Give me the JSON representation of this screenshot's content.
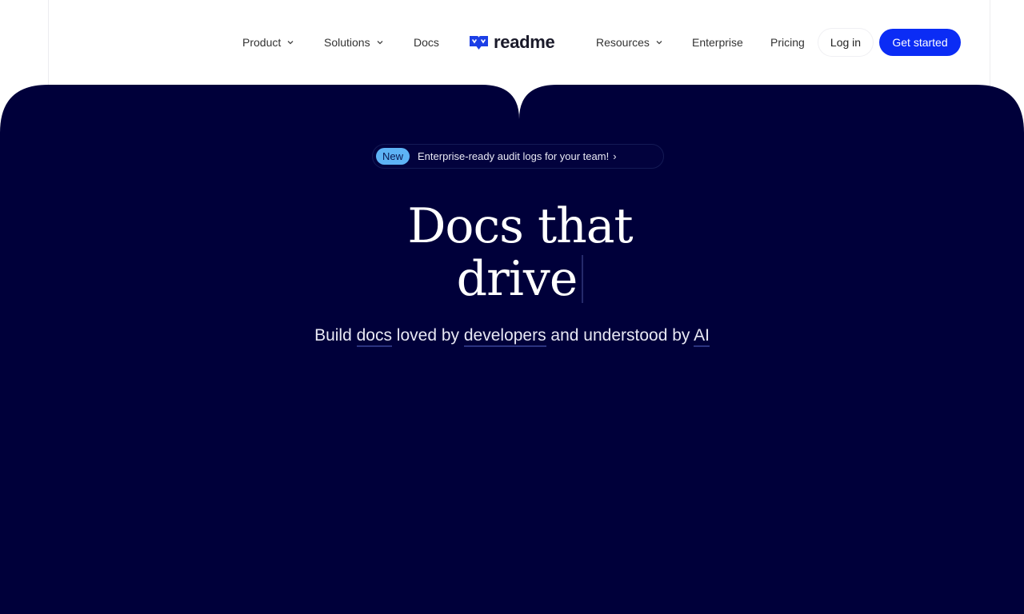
{
  "nav": {
    "left": [
      {
        "label": "Product",
        "has_dropdown": true
      },
      {
        "label": "Solutions",
        "has_dropdown": true
      },
      {
        "label": "Docs",
        "has_dropdown": false
      }
    ],
    "logo_text": "readme",
    "right": [
      {
        "label": "Resources",
        "has_dropdown": true
      },
      {
        "label": "Enterprise",
        "has_dropdown": false
      },
      {
        "label": "Pricing",
        "has_dropdown": false
      }
    ],
    "login_label": "Log in",
    "cta_label": "Get started"
  },
  "hero": {
    "badge": "New",
    "announcement": "Enterprise-ready audit logs for your team!",
    "announcement_arrow": "›",
    "headline_line1": "Docs that",
    "headline_line2": "drive",
    "subline": {
      "p1": "Build ",
      "u1": "docs",
      "p2": " loved by ",
      "u2": "developers",
      "p3": " and understood by ",
      "u3": "AI"
    }
  },
  "colors": {
    "hero_bg": "#00003a",
    "accent_blue": "#0b2cf5",
    "badge_blue": "#5db3f5"
  },
  "icons": {
    "dropdown": "chevron-down-icon",
    "logo": "readme-logo-icon"
  }
}
